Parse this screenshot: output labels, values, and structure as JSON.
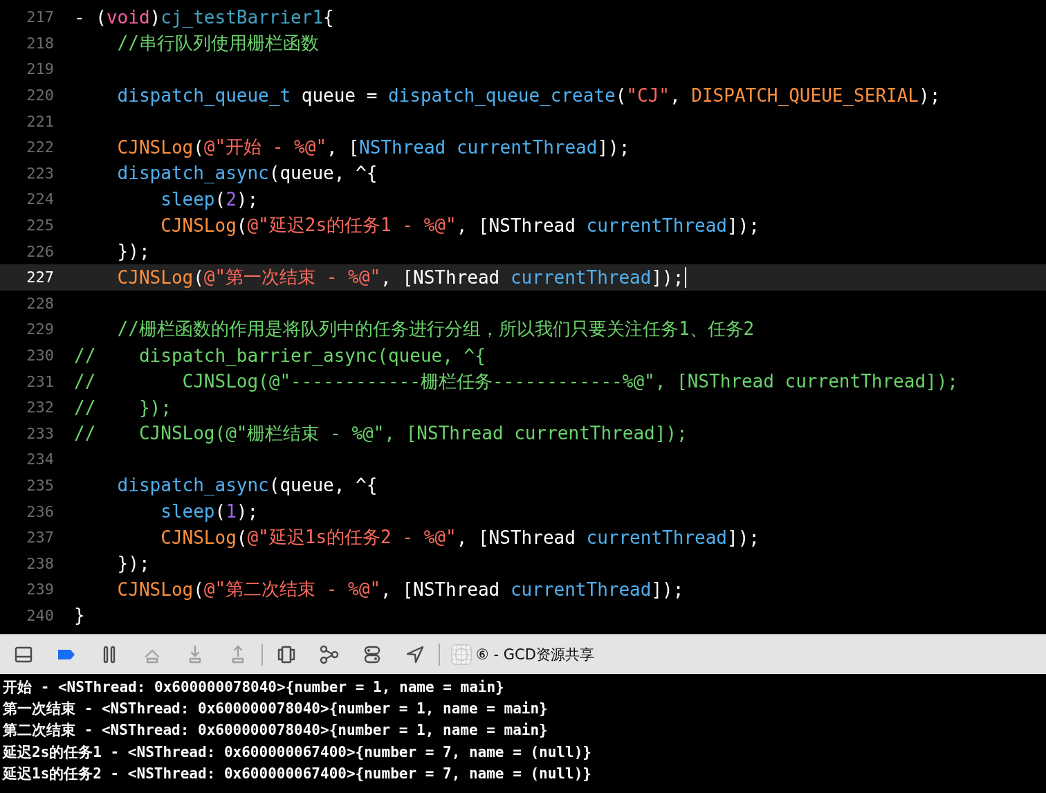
{
  "editor": {
    "lines": [
      {
        "number": "217",
        "current": false,
        "tokens": [
          {
            "text": "- (",
            "kind": "p"
          },
          {
            "text": "void",
            "kind": "kw"
          },
          {
            "text": ")",
            "kind": "p"
          },
          {
            "text": "cj_testBarrier1",
            "kind": "meth"
          },
          {
            "text": "{",
            "kind": "p"
          }
        ]
      },
      {
        "number": "218",
        "current": false,
        "tokens": [
          {
            "text": "    //串行队列使用栅栏函数",
            "kind": "com"
          }
        ]
      },
      {
        "number": "219",
        "current": false
      },
      {
        "number": "220",
        "current": false,
        "tokens": [
          {
            "text": "    dispatch_queue_t",
            "kind": "fn"
          },
          {
            "text": " queue = ",
            "kind": "p"
          },
          {
            "text": "dispatch_queue_create",
            "kind": "fn"
          },
          {
            "text": "(",
            "kind": "p"
          },
          {
            "text": "\"CJ\"",
            "kind": "str"
          },
          {
            "text": ", ",
            "kind": "p"
          },
          {
            "text": "DISPATCH_QUEUE_SERIAL",
            "kind": "mac"
          },
          {
            "text": ");",
            "kind": "p"
          }
        ]
      },
      {
        "number": "221",
        "current": false
      },
      {
        "number": "222",
        "current": false,
        "tokens": [
          {
            "text": "    CJNSLog",
            "kind": "mac"
          },
          {
            "text": "(",
            "kind": "p"
          },
          {
            "text": "@\"开始 - %@\"",
            "kind": "str"
          },
          {
            "text": ", [",
            "kind": "p"
          },
          {
            "text": "NSThread",
            "kind": "fn"
          },
          {
            "text": " currentThread",
            "kind": "fn"
          },
          {
            "text": "]);",
            "kind": "p"
          }
        ]
      },
      {
        "number": "223",
        "current": false,
        "tokens": [
          {
            "text": "    dispatch_async",
            "kind": "fn"
          },
          {
            "text": "(queue, ^{",
            "kind": "p"
          }
        ]
      },
      {
        "number": "224",
        "current": false,
        "tokens": [
          {
            "text": "        sleep",
            "kind": "fn"
          },
          {
            "text": "(",
            "kind": "p"
          },
          {
            "text": "2",
            "kind": "num"
          },
          {
            "text": ");",
            "kind": "p"
          }
        ]
      },
      {
        "number": "225",
        "current": false,
        "tokens": [
          {
            "text": "        CJNSLog",
            "kind": "mac"
          },
          {
            "text": "(",
            "kind": "p"
          },
          {
            "text": "@\"延迟2s的任务1 - %@\"",
            "kind": "str"
          },
          {
            "text": ", [NSThread ",
            "kind": "p"
          },
          {
            "text": "currentThread",
            "kind": "fn"
          },
          {
            "text": "]);",
            "kind": "p"
          }
        ]
      },
      {
        "number": "226",
        "current": false,
        "tokens": [
          {
            "text": "    });",
            "kind": "p"
          }
        ]
      },
      {
        "number": "227",
        "current": true,
        "tokens": [
          {
            "text": "    CJNSLog",
            "kind": "mac"
          },
          {
            "text": "(",
            "kind": "p"
          },
          {
            "text": "@\"第一次结束 - %@\"",
            "kind": "str"
          },
          {
            "text": ", [NSThread ",
            "kind": "p"
          },
          {
            "text": "currentThread",
            "kind": "fn"
          },
          {
            "text": "]);",
            "kind": "p"
          }
        ]
      },
      {
        "number": "228",
        "current": false
      },
      {
        "number": "229",
        "current": false,
        "tokens": [
          {
            "text": "    //栅栏函数的作用是将队列中的任务进行分组，所以我们只要关注任务1、任务2",
            "kind": "com"
          }
        ]
      },
      {
        "number": "230",
        "current": false,
        "tokens": [
          {
            "text": "//    dispatch_barrier_async(queue, ^{",
            "kind": "com"
          }
        ]
      },
      {
        "number": "231",
        "current": false,
        "tokens": [
          {
            "text": "//        CJNSLog(@\"------------栅栏任务------------%@\", [NSThread currentThread]);",
            "kind": "com"
          }
        ]
      },
      {
        "number": "232",
        "current": false,
        "tokens": [
          {
            "text": "//    });",
            "kind": "com"
          }
        ]
      },
      {
        "number": "233",
        "current": false,
        "tokens": [
          {
            "text": "//    CJNSLog(@\"栅栏结束 - %@\", [NSThread currentThread]);",
            "kind": "com"
          }
        ]
      },
      {
        "number": "234",
        "current": false
      },
      {
        "number": "235",
        "current": false,
        "tokens": [
          {
            "text": "    dispatch_async",
            "kind": "fn"
          },
          {
            "text": "(queue, ^{",
            "kind": "p"
          }
        ]
      },
      {
        "number": "236",
        "current": false,
        "tokens": [
          {
            "text": "        sleep",
            "kind": "fn"
          },
          {
            "text": "(",
            "kind": "p"
          },
          {
            "text": "1",
            "kind": "num"
          },
          {
            "text": ");",
            "kind": "p"
          }
        ]
      },
      {
        "number": "237",
        "current": false,
        "tokens": [
          {
            "text": "        CJNSLog",
            "kind": "mac"
          },
          {
            "text": "(",
            "kind": "p"
          },
          {
            "text": "@\"延迟1s的任务2 - %@\"",
            "kind": "str"
          },
          {
            "text": ", [NSThread ",
            "kind": "p"
          },
          {
            "text": "currentThread",
            "kind": "fn"
          },
          {
            "text": "]);",
            "kind": "p"
          }
        ]
      },
      {
        "number": "238",
        "current": false,
        "tokens": [
          {
            "text": "    });",
            "kind": "p"
          }
        ]
      },
      {
        "number": "239",
        "current": false,
        "tokens": [
          {
            "text": "    CJNSLog",
            "kind": "mac"
          },
          {
            "text": "(",
            "kind": "p"
          },
          {
            "text": "@\"第二次结束 - %@\"",
            "kind": "str"
          },
          {
            "text": ", [NSThread ",
            "kind": "p"
          },
          {
            "text": "currentThread",
            "kind": "fn"
          },
          {
            "text": "]);",
            "kind": "p"
          }
        ]
      },
      {
        "number": "240",
        "current": false,
        "tokens": [
          {
            "text": "}",
            "kind": "p"
          }
        ]
      }
    ]
  },
  "debug_bar": {
    "groups": [
      [
        {
          "kind": "panel",
          "on": false,
          "disabled": false
        },
        {
          "kind": "breakpoints",
          "on": true,
          "disabled": false
        },
        {
          "kind": "pause",
          "on": false,
          "disabled": false
        },
        {
          "kind": "step-over",
          "on": false,
          "disabled": true
        },
        {
          "kind": "step-into",
          "on": false,
          "disabled": true
        },
        {
          "kind": "step-out",
          "on": false,
          "disabled": true
        }
      ],
      [
        {
          "kind": "view-debugger",
          "on": false,
          "disabled": false
        },
        {
          "kind": "memory-graph",
          "on": false,
          "disabled": false
        },
        {
          "kind": "environment",
          "on": false,
          "disabled": false
        },
        {
          "kind": "location",
          "on": false,
          "disabled": false
        }
      ]
    ],
    "target": {
      "label": "⑥ - GCD资源共享"
    }
  },
  "console": {
    "lines": [
      "开始 - <NSThread: 0x600000078040>{number = 1, name = main}",
      "第一次结束 - <NSThread: 0x600000078040>{number = 1, name = main}",
      "第二次结束 - <NSThread: 0x600000078040>{number = 1, name = main}",
      "延迟2s的任务1 - <NSThread: 0x600000067400>{number = 7, name = (null)}",
      "延迟1s的任务2 - <NSThread: 0x600000067400>{number = 7, name = (null)}"
    ]
  }
}
